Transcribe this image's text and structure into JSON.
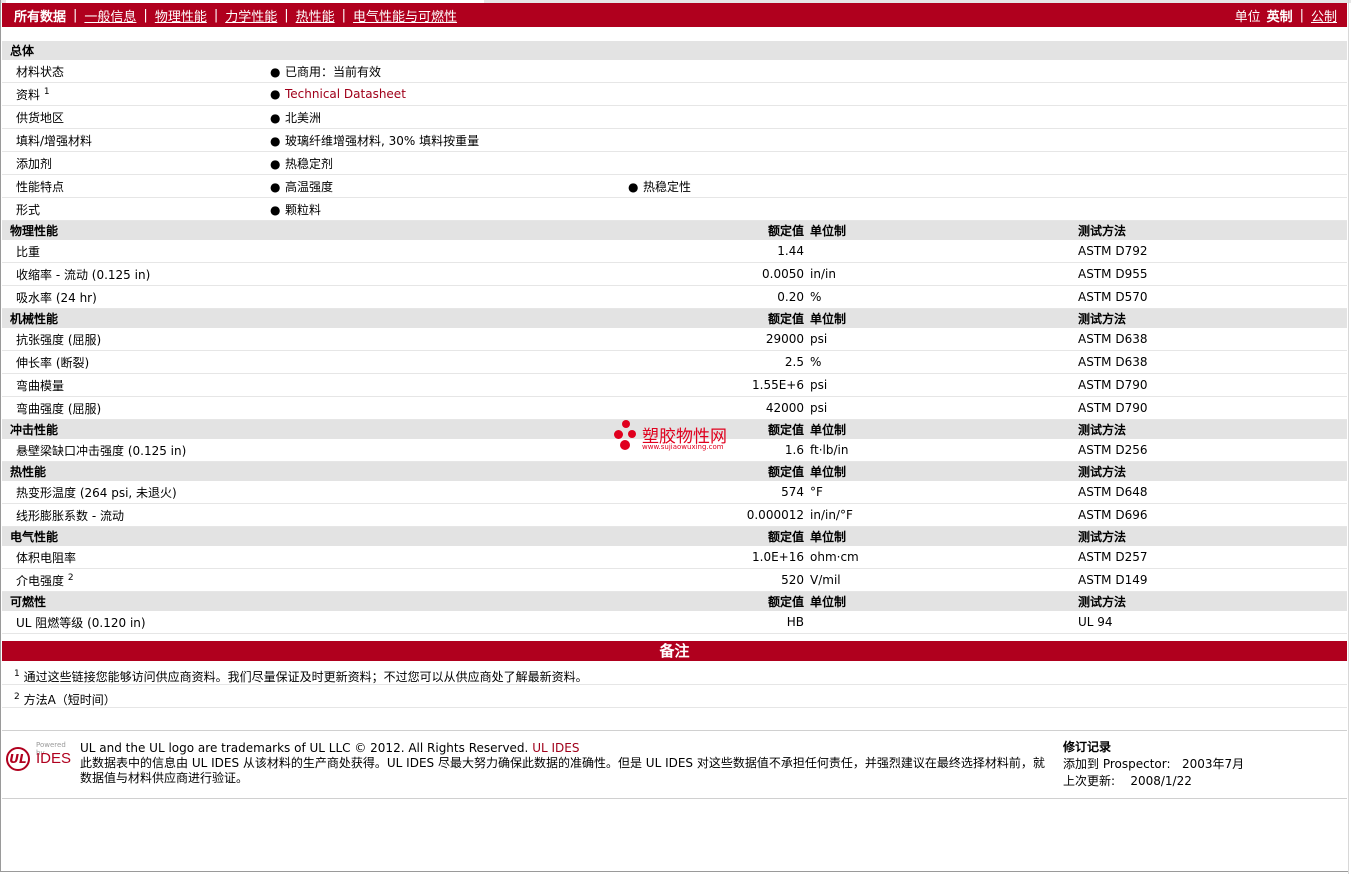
{
  "nav": {
    "items": [
      "所有数据",
      "一般信息",
      "物理性能",
      "力学性能",
      "热性能",
      "电气性能与可燃性"
    ],
    "unit_label": "单位",
    "unit_options": [
      "英制",
      "公制"
    ]
  },
  "general": {
    "title": "总体",
    "rows": [
      {
        "label": "材料状态",
        "values": [
          "已商用：当前有效"
        ]
      },
      {
        "label": "资料",
        "sup": "1",
        "values": [
          "Technical Datasheet"
        ]
      },
      {
        "label": "供货地区",
        "values": [
          "北美洲"
        ]
      },
      {
        "label": "填料/增强材料",
        "values": [
          "玻璃纤维增强材料, 30% 填料按重量"
        ]
      },
      {
        "label": "添加剂",
        "values": [
          "热稳定剂"
        ]
      },
      {
        "label": "性能特点",
        "values": [
          "高温强度",
          "热稳定性"
        ]
      },
      {
        "label": "形式",
        "values": [
          "颗粒料"
        ]
      }
    ]
  },
  "column_headers": {
    "value": "额定值",
    "unit": "单位制",
    "method": "测试方法"
  },
  "sections": [
    {
      "title": "物理性能",
      "rows": [
        {
          "name": "比重",
          "value": "1.44",
          "unit": "",
          "method": "ASTM D792"
        },
        {
          "name": "收缩率  - 流动  (0.125 in)",
          "value": "0.0050",
          "unit": "in/in",
          "method": "ASTM D955"
        },
        {
          "name": "吸水率  (24 hr)",
          "value": "0.20",
          "unit": "%",
          "method": "ASTM D570"
        }
      ]
    },
    {
      "title": "机械性能",
      "rows": [
        {
          "name": "抗张强度  (屈服)",
          "value": "29000",
          "unit": "psi",
          "method": "ASTM D638"
        },
        {
          "name": "伸长率  (断裂)",
          "value": "2.5",
          "unit": "%",
          "method": "ASTM D638"
        },
        {
          "name": "弯曲模量",
          "value": "1.55E+6",
          "unit": "psi",
          "method": "ASTM D790"
        },
        {
          "name": "弯曲强度  (屈服)",
          "value": "42000",
          "unit": "psi",
          "method": "ASTM D790"
        }
      ]
    },
    {
      "title": "冲击性能",
      "rows": [
        {
          "name": "悬壁梁缺口冲击强度  (0.125 in)",
          "value": "1.6",
          "unit": "ft·lb/in",
          "method": "ASTM D256"
        }
      ]
    },
    {
      "title": "热性能",
      "rows": [
        {
          "name": "热变形温度  (264 psi, 未退火)",
          "value": "574",
          "unit": "°F",
          "method": "ASTM D648"
        },
        {
          "name": "线形膨胀系数  - 流动",
          "value": "0.000012",
          "unit": "in/in/°F",
          "method": "ASTM D696"
        }
      ]
    },
    {
      "title": "电气性能",
      "rows": [
        {
          "name": "体积电阻率",
          "value": "1.0E+16",
          "unit": "ohm·cm",
          "method": "ASTM D257"
        },
        {
          "name": "介电强度",
          "sup": "2",
          "value": "520",
          "unit": "V/mil",
          "method": "ASTM D149"
        }
      ]
    },
    {
      "title": "可燃性",
      "rows": [
        {
          "name": "UL 阻燃等级  (0.120 in)",
          "value": "HB",
          "unit": "",
          "method": "UL 94"
        }
      ]
    }
  ],
  "notes": {
    "title": "备注",
    "items": [
      {
        "num": "1",
        "text": "通过这些链接您能够访问供应商资料。我们尽量保证及时更新资料；不过您可以从供应商处了解最新资料。"
      },
      {
        "num": "2",
        "text": "方法A（短时间）"
      }
    ]
  },
  "footer": {
    "logo_ul": "UL",
    "logo_powered": "Powered by",
    "logo_ides": "IDES",
    "trademark": "UL and the UL logo are trademarks of UL LLC © 2012. All Rights Reserved.",
    "trademark_link": "UL IDES",
    "disclaimer": "此数据表中的信息由  UL IDES 从该材料的生产商处获得。UL IDES 尽最大努力确保此数据的准确性。但是  UL IDES 对这些数据值不承担任何责任，并强烈建议在最终选择材料前，就数据值与材料供应商进行验证。",
    "revision_title": "修订记录",
    "added_label": "添加到  Prospector:",
    "added_value": "2003年7月",
    "updated_label": "上次更新:",
    "updated_value": "2008/1/22"
  },
  "watermark": {
    "text": "塑胶物性网",
    "url": "www.sujiaowuxing.com"
  },
  "colors": {
    "brand": "#b0001e",
    "section_bg": "#e3e3e3",
    "link": "#a0001a"
  }
}
